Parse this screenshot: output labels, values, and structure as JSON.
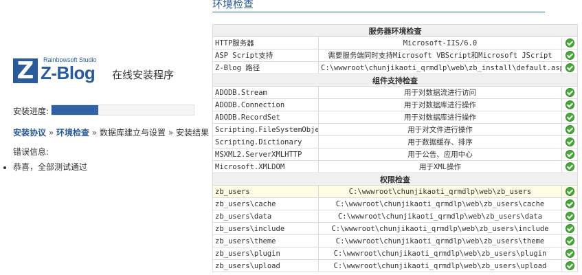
{
  "logo": {
    "studio": "Rainbowsoft Studio",
    "name": "Z-Blog",
    "subtitle": "在线安装程序",
    "letter": "Z"
  },
  "progress": {
    "label": "安装进度:",
    "value_percent": 33
  },
  "steps": {
    "items": [
      "安装协议",
      "环境检查",
      "数据库建立与设置",
      "安装结果"
    ],
    "separator": "»",
    "done_count": 2
  },
  "errors": {
    "label": "错误信息:",
    "items": [
      "恭喜，全部测试通过"
    ]
  },
  "main": {
    "title": "环境检查"
  },
  "env_table": {
    "sections": [
      {
        "header": "服务器环境检查",
        "rows": [
          {
            "name": "HTTP服务器",
            "value": "Microsoft-IIS/6.0",
            "status": "ok"
          },
          {
            "name": "ASP Script支持",
            "value": "需要服务端同时支持Microsoft VBScript和Microsoft JScript",
            "status": "ok"
          },
          {
            "name": "Z-Blog 路径",
            "value": "C:\\wwwroot\\chunjikaoti_qrmdlp\\web\\zb_install\\default.asp",
            "status": "ok"
          }
        ]
      },
      {
        "header": "组件支持检查",
        "rows": [
          {
            "name": "ADODB.Stream",
            "value": "用于对数据流进行访问",
            "status": "ok"
          },
          {
            "name": "ADODB.Connection",
            "value": "用于对数据库进行操作",
            "status": "ok"
          },
          {
            "name": "ADODB.RecordSet",
            "value": "用于对数据库进行操作",
            "status": "ok"
          },
          {
            "name": "Scripting.FileSystemObject",
            "value": "用于对文件进行操作",
            "status": "ok"
          },
          {
            "name": "Scripting.Dictionary",
            "value": "用于数据缓存、排序",
            "status": "ok"
          },
          {
            "name": "MSXML2.ServerXMLHTTP",
            "value": "用于公告、应用中心",
            "status": "ok"
          },
          {
            "name": "Microsoft.XMLDOM",
            "value": "用于XML操作",
            "status": "ok"
          }
        ]
      },
      {
        "header": "权限检查",
        "rows": [
          {
            "name": "zb_users",
            "value": "C:\\wwwroot\\chunjikaoti_qrmdlp\\web\\zb_users",
            "status": "ok",
            "highlight": true
          },
          {
            "name": "zb_users\\cache",
            "value": "C:\\wwwroot\\chunjikaoti_qrmdlp\\web\\zb_users\\cache",
            "status": "ok"
          },
          {
            "name": "zb_users\\data",
            "value": "C:\\wwwroot\\chunjikaoti_qrmdlp\\web\\zb_users\\data",
            "status": "ok"
          },
          {
            "name": "zb_users\\include",
            "value": "C:\\wwwroot\\chunjikaoti_qrmdlp\\web\\zb_users\\include",
            "status": "ok"
          },
          {
            "name": "zb_users\\theme",
            "value": "C:\\wwwroot\\chunjikaoti_qrmdlp\\web\\zb_users\\theme",
            "status": "ok"
          },
          {
            "name": "zb_users\\plugin",
            "value": "C:\\wwwroot\\chunjikaoti_qrmdlp\\web\\zb_users\\plugin",
            "status": "ok"
          },
          {
            "name": "zb_users\\upload",
            "value": "C:\\wwwroot\\chunjikaoti_qrmdlp\\web\\zb_users\\upload",
            "status": "ok"
          }
        ]
      }
    ]
  }
}
